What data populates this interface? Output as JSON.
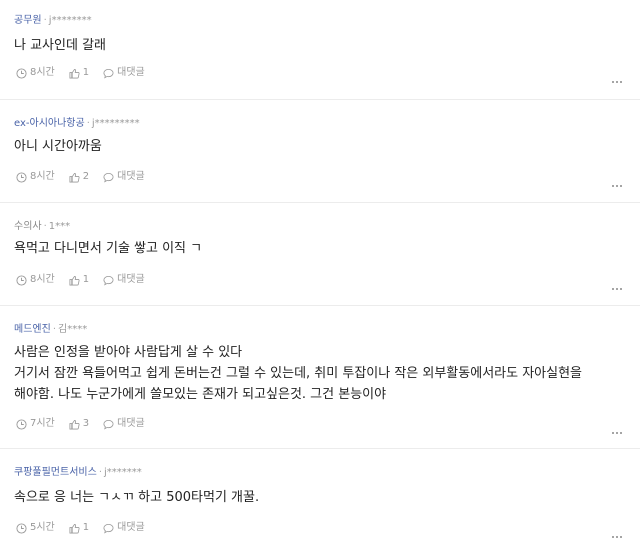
{
  "comments": [
    {
      "company": "공무원",
      "separator": "·",
      "user": "j********",
      "lines": [
        "나 교사인데 갈래"
      ],
      "time": "8시간",
      "likes": "1",
      "reply_label": "대댓글"
    },
    {
      "company": "ex-아시아나항공",
      "separator": "·",
      "user": "j*********",
      "lines": [
        "아니 시간아까움"
      ],
      "time": "8시간",
      "likes": "2",
      "reply_label": "대댓글"
    },
    {
      "company": "수의사",
      "separator": "·",
      "user": "1***",
      "lines": [
        "욕먹고 다니면서 기술 쌓고 이직 ㄱ"
      ],
      "time": "8시간",
      "likes": "1",
      "reply_label": "대댓글"
    },
    {
      "company": "메드엔진",
      "separator": "·",
      "user": "김****",
      "lines": [
        "사람은 인정을 받아야 사람답게 살 수 있다",
        "거기서 잠깐 욕들어먹고 쉽게 돈버는건 그럴 수 있는데, 취미 투잡이나 작은 외부활동에서라도 자아실현을",
        "해야함. 나도 누군가에게 쓸모있는 존재가 되고싶은것. 그건 본능이야"
      ],
      "time": "7시간",
      "likes": "3",
      "reply_label": "대댓글"
    },
    {
      "company": "쿠팡풀필먼트서비스",
      "separator": "·",
      "user": "j*******",
      "lines": [
        "속으로 응 너는 ㄱㅅㄲ 하고 500타먹기 개꿀."
      ],
      "time": "5시간",
      "likes": "1",
      "reply_label": "대댓글"
    }
  ]
}
